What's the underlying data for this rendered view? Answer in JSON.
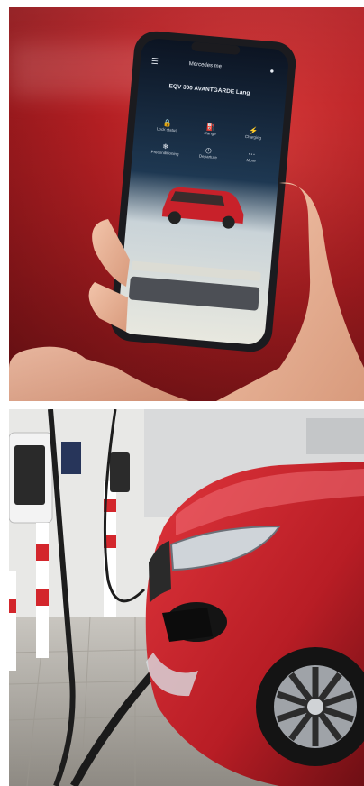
{
  "photos": [
    {
      "icons": [
        "menu-icon",
        "profile-icon",
        "status-icons"
      ]
    },
    {
      "icons": [
        "mercedes-star-icon"
      ]
    }
  ],
  "phone_app": {
    "header_title": "Mercedes me",
    "vehicle_name": "EQV 300 AVANTGARDE Lang",
    "tiles": [
      {
        "label": "Lock status"
      },
      {
        "label": "Range"
      },
      {
        "label": "Charging"
      },
      {
        "label": "Preconditioning"
      },
      {
        "label": "Departure"
      },
      {
        "label": "More"
      }
    ]
  },
  "colors": {
    "background_red": "#b51f23",
    "car_red": "#c8212a",
    "phone_frame": "#1b1b1f",
    "app_dark": "#0f1726",
    "wall": "#e8e8e6",
    "pavement": "#a5a29c"
  }
}
